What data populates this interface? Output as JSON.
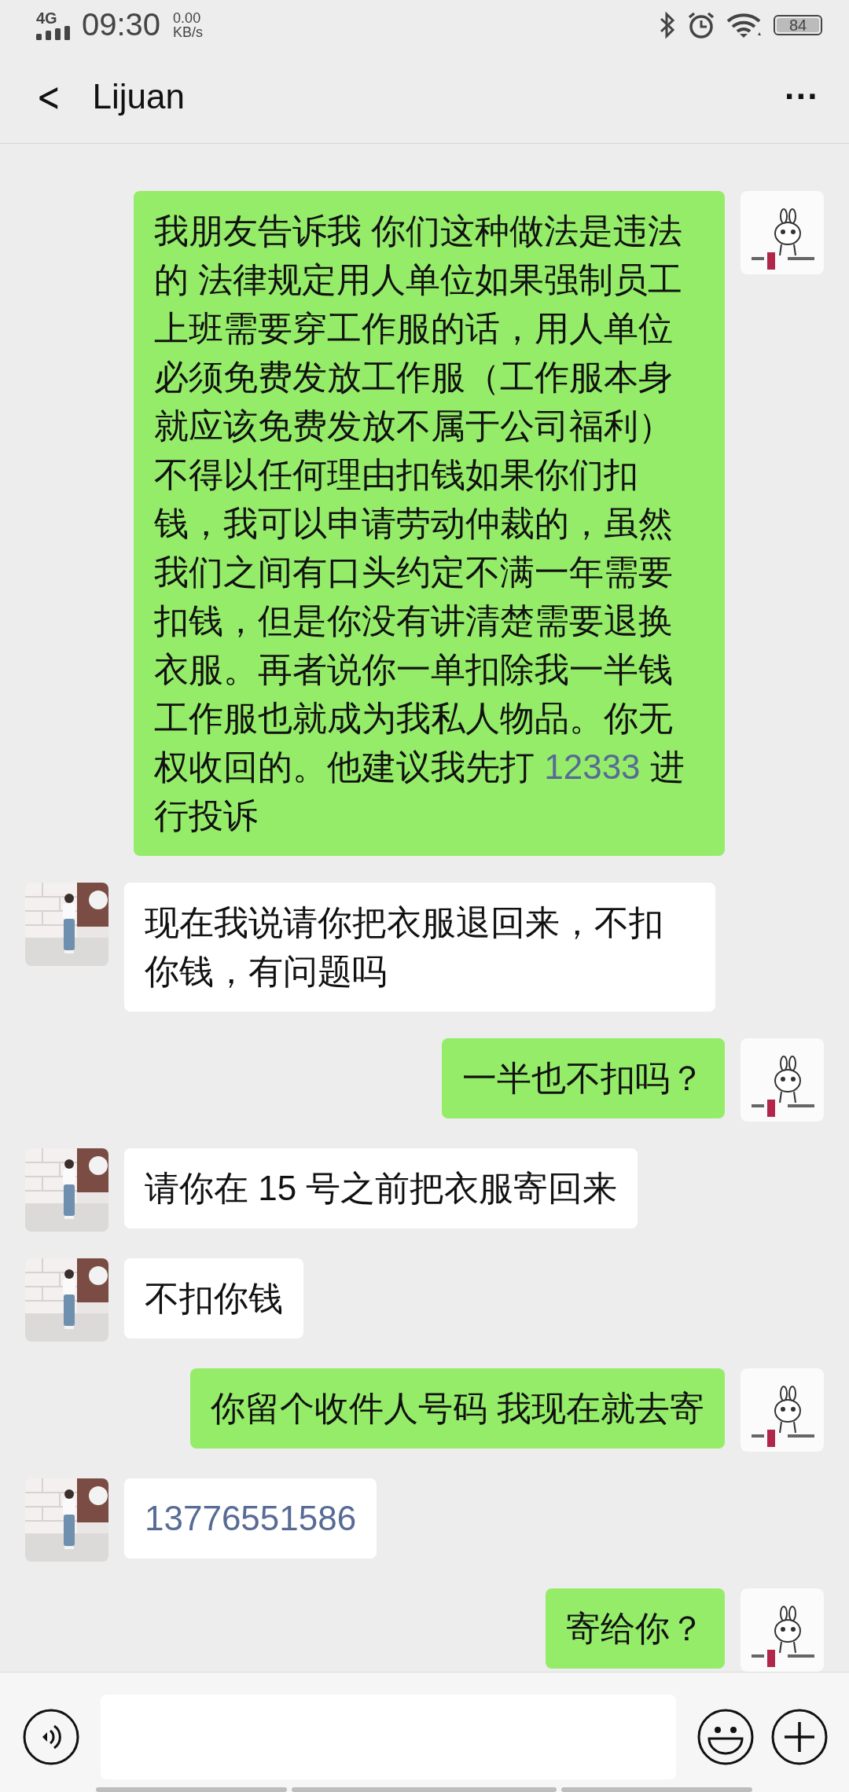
{
  "status_bar": {
    "network": "4G",
    "time": "09:30",
    "speed_value": "0.00",
    "speed_unit": "KB/s",
    "battery": "84"
  },
  "header": {
    "back": "<",
    "title": "Lijuan",
    "more": "···"
  },
  "messages": [
    {
      "kind": "sent",
      "parts": [
        {
          "kind": "text",
          "text": "我朋友告诉我 你们这种做法是违法的 法律规定用人单位如果强制员工上班需要穿工作服的话，用人单位必须免费发放工作服（工作服本身就应该免费发放不属于公司福利）不得以任何理由扣钱如果你们扣钱，我可以申请劳动仲裁的，虽然我们之间有口头约定不满一年需要扣钱，但是你没有讲清楚需要退换衣服。再者说你一单扣除我一半钱工作服也就成为我私人物品。你无权收回的。他建议我先打 "
        },
        {
          "kind": "link",
          "text": "12333"
        },
        {
          "kind": "text",
          "text": " 进行投诉"
        }
      ]
    },
    {
      "kind": "received",
      "parts": [
        {
          "kind": "text",
          "text": "现在我说请你把衣服退回来，不扣你钱，有问题吗"
        }
      ]
    },
    {
      "kind": "sent",
      "parts": [
        {
          "kind": "text",
          "text": "一半也不扣吗？"
        }
      ]
    },
    {
      "kind": "received",
      "parts": [
        {
          "kind": "text",
          "text": "请你在 15 号之前把衣服寄回来"
        }
      ]
    },
    {
      "kind": "received",
      "parts": [
        {
          "kind": "text",
          "text": "不扣你钱"
        }
      ]
    },
    {
      "kind": "sent",
      "parts": [
        {
          "kind": "text",
          "text": "你留个收件人号码 我现在就去寄"
        }
      ]
    },
    {
      "kind": "received",
      "parts": [
        {
          "kind": "link",
          "text": "13776551586"
        }
      ]
    },
    {
      "kind": "sent",
      "parts": [
        {
          "kind": "text",
          "text": "寄给你？"
        }
      ]
    }
  ]
}
